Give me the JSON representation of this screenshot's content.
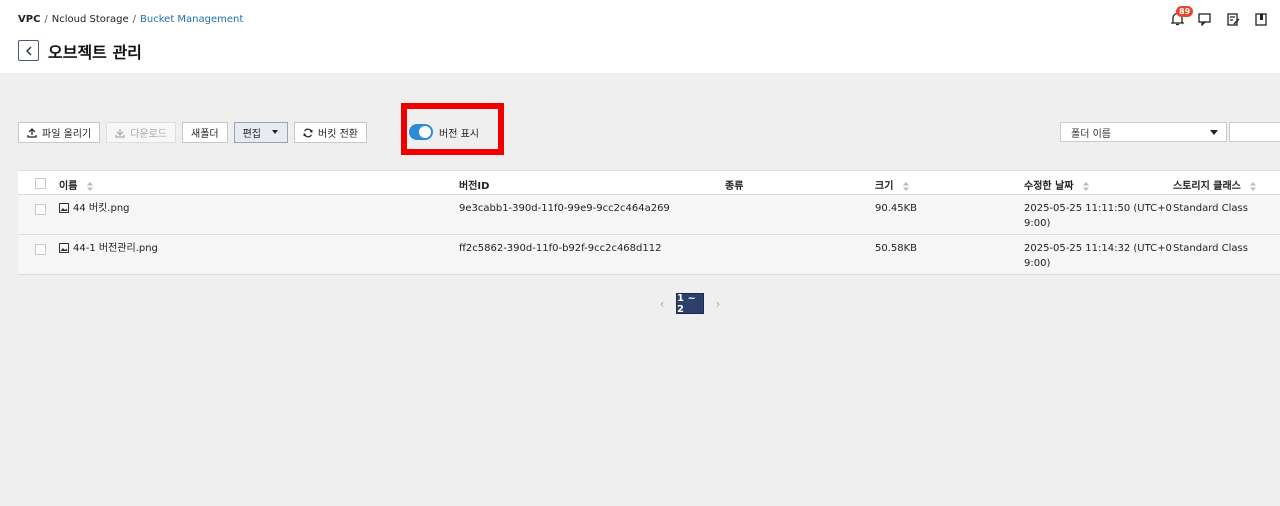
{
  "breadcrumb": {
    "items": [
      "VPC",
      "Ncloud Storage",
      "Bucket Management"
    ],
    "sep": "/"
  },
  "page": {
    "title": "오브젝트 관리"
  },
  "header": {
    "notification_count": "89"
  },
  "toolbar": {
    "upload_label": "파일 올리기",
    "download_label": "다운로드",
    "new_folder_label": "새폴더",
    "edit_label": "편집",
    "switch_bucket_label": "버킷 전환",
    "version_toggle_label": "버전 표시",
    "version_toggle_on": true
  },
  "filter": {
    "select_value": "폴더 이름"
  },
  "table": {
    "columns": {
      "name": "이름",
      "version_id": "버전ID",
      "type": "종류",
      "size": "크기",
      "modified": "수정한 날짜",
      "storage_class": "스토리지 클래스"
    },
    "rows": [
      {
        "name": "44 버킷.png",
        "version_id": "9e3cabb1-390d-11f0-99e9-9cc2c464a269",
        "type": "",
        "size": "90.45KB",
        "modified_line1": "2025-05-25 11:11:50 (UTC+0",
        "modified_line2": "9:00)",
        "storage_class": "Standard Class"
      },
      {
        "name": "44-1 버전관리.png",
        "version_id": "ff2c5862-390d-11f0-b92f-9cc2c468d112",
        "type": "",
        "size": "50.58KB",
        "modified_line1": "2025-05-25 11:14:32 (UTC+0",
        "modified_line2": "9:00)",
        "storage_class": "Standard Class"
      }
    ]
  },
  "pagination": {
    "current": "1 ~ 2",
    "prev": "‹",
    "next": "›"
  },
  "colors": {
    "accent": "#2a8bd6",
    "highlight": "#ee0000",
    "page_btn": "#2d3f6b"
  }
}
